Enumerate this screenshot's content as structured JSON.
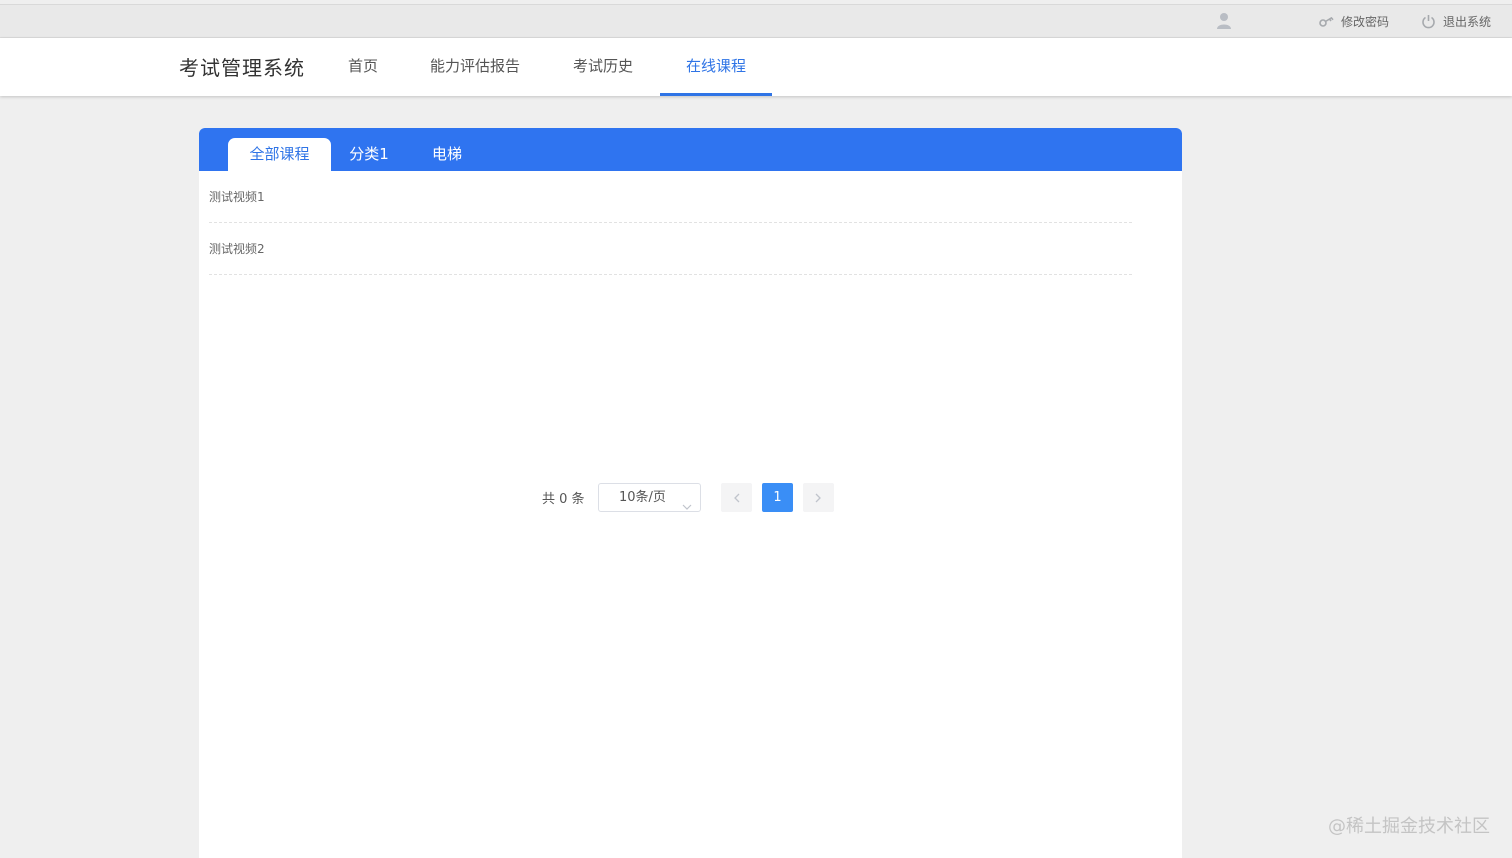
{
  "topbar": {
    "user_icon": "user-icon",
    "change_password": "修改密码",
    "logout": "退出系统"
  },
  "header": {
    "brand": "考试管理系统",
    "nav": [
      {
        "label": "首页"
      },
      {
        "label": "能力评估报告"
      },
      {
        "label": "考试历史"
      },
      {
        "label": "在线课程",
        "active": true
      }
    ]
  },
  "tabs": [
    {
      "label": "全部课程",
      "active": true
    },
    {
      "label": "分类1"
    },
    {
      "label": "电梯"
    }
  ],
  "courses": [
    {
      "title": "测试视频1"
    },
    {
      "title": "测试视频2"
    }
  ],
  "pagination": {
    "total_text": "共 0 条",
    "page_size": "10条/页",
    "current_page": "1"
  },
  "colors": {
    "accent": "#2f74f0",
    "page_active": "#3a8ef6"
  },
  "watermark": "@稀土掘金技术社区"
}
